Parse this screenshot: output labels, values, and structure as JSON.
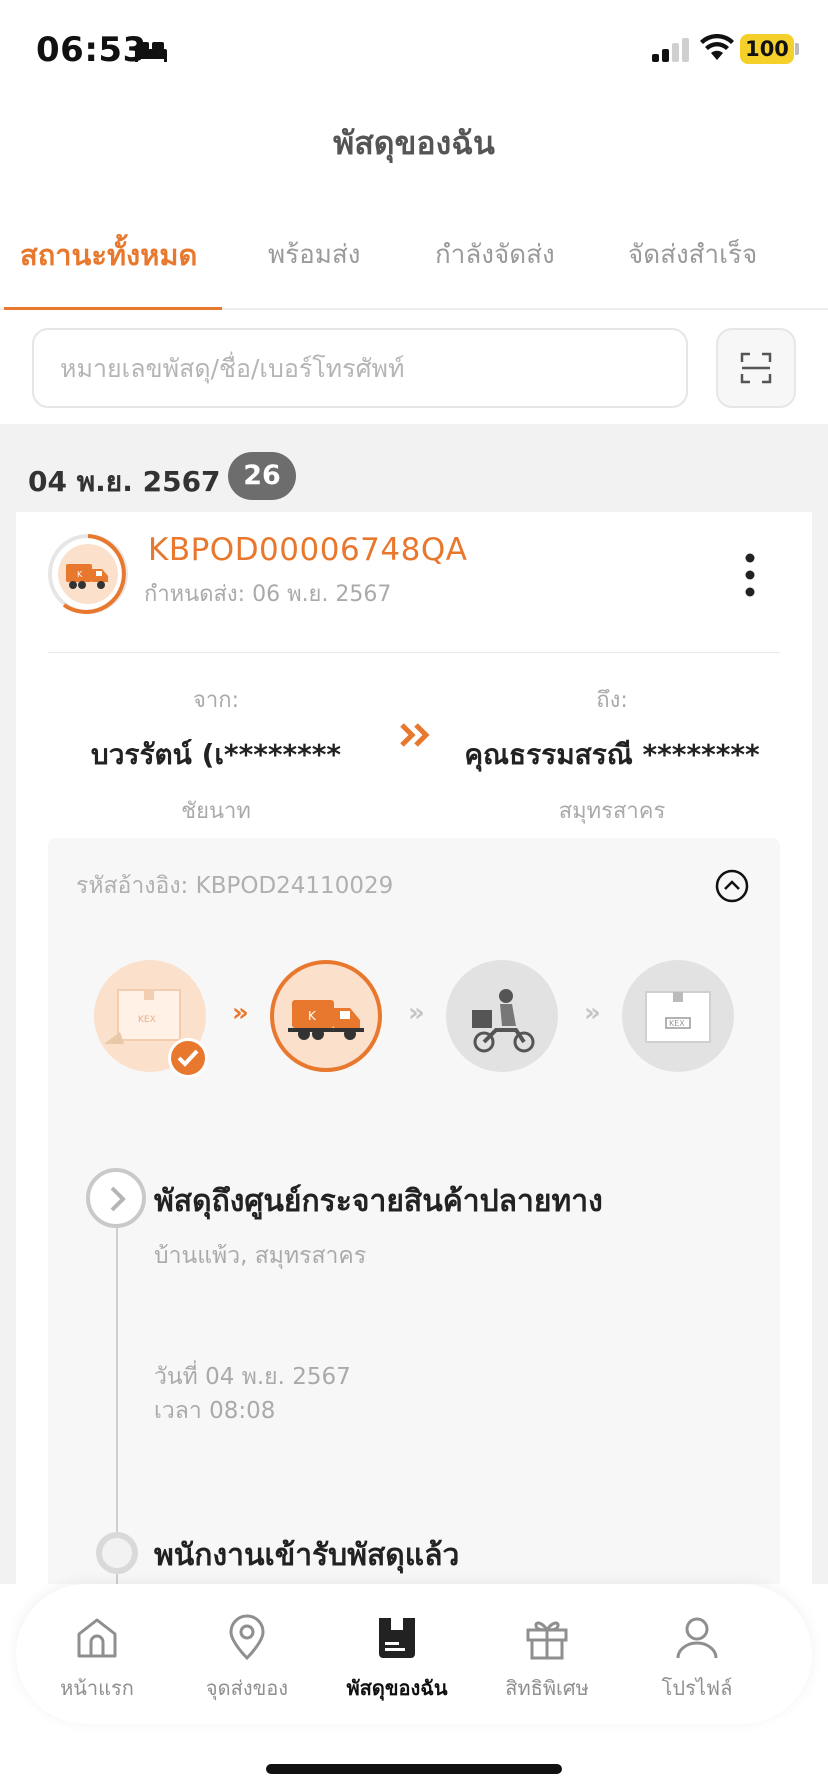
{
  "status_bar": {
    "time": "06:53",
    "battery": "100"
  },
  "page_title": "พัสดุของฉัน",
  "tabs": [
    {
      "label": "สถานะทั้งหมด",
      "active": true
    },
    {
      "label": "พร้อมส่ง",
      "active": false
    },
    {
      "label": "กำลังจัดส่ง",
      "active": false
    },
    {
      "label": "จัดส่งสำเร็จ",
      "active": false
    }
  ],
  "search": {
    "placeholder": "หมายเลขพัสดุ/ชื่อ/เบอร์โทรศัพท์",
    "value": ""
  },
  "group": {
    "date": "04 พ.ย. 2567",
    "count": "26"
  },
  "parcel": {
    "tracking_number": "KBPOD00006748QA",
    "due_date": "กำหนดส่ง: 06 พ.ย. 2567",
    "sender": {
      "label": "จาก:",
      "name": "บวรรัตน์ (เ********",
      "location": "ชัยนาท"
    },
    "receiver": {
      "label": "ถึง:",
      "name": "คุณธรรมสรณี ********",
      "location": "สมุทรสาคร"
    },
    "reference": "รหัสอ้างอิง: KBPOD24110029",
    "steps": [
      {
        "name": "picked-up",
        "state": "done"
      },
      {
        "name": "in-transit",
        "state": "current"
      },
      {
        "name": "out-for-delivery",
        "state": "pending"
      },
      {
        "name": "delivered",
        "state": "pending"
      }
    ],
    "events": [
      {
        "title": "พัสดุถึงศูนย์กระจายสินค้าปลายทาง",
        "location": "บ้านแพ้ว, สมุทรสาคร",
        "date": "วันที่ 04 พ.ย. 2567",
        "time": "เวลา 08:08"
      },
      {
        "title": "พนักงานเข้ารับพัสดุแล้ว",
        "location": "",
        "date": "",
        "time": ""
      }
    ]
  },
  "bottom_nav": [
    {
      "label": "หน้าแรก",
      "icon": "home-icon",
      "active": false
    },
    {
      "label": "จุดส่งของ",
      "icon": "location-pin-icon",
      "active": false
    },
    {
      "label": "พัสดุของฉัน",
      "icon": "parcel-icon",
      "active": true
    },
    {
      "label": "สิทธิพิเศษ",
      "icon": "gift-icon",
      "active": false
    },
    {
      "label": "โปรไฟล์",
      "icon": "profile-icon",
      "active": false
    }
  ],
  "colors": {
    "accent": "#e8782e",
    "badge": "#6d6d6d",
    "text_muted": "#aaaaaa"
  }
}
